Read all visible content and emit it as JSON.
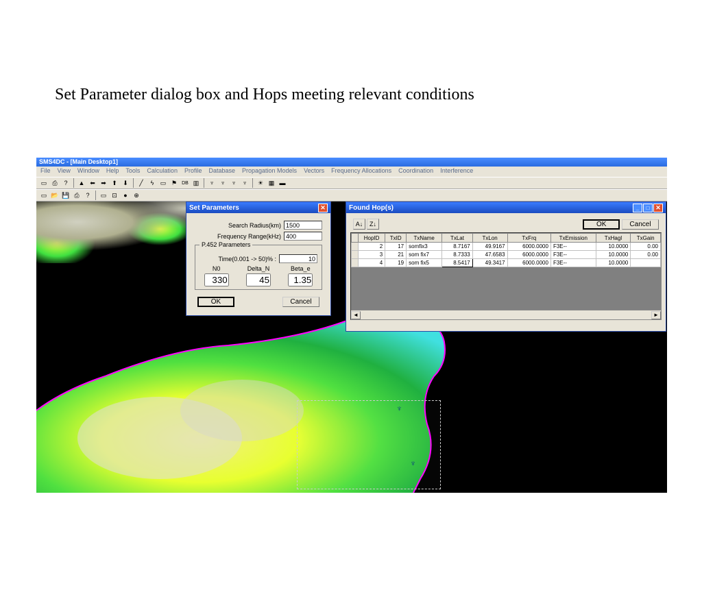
{
  "slide": {
    "title": "Set Parameter dialog box and Hops meeting relevant conditions"
  },
  "app": {
    "title": "SMS4DC - [Main Desktop1]",
    "menus": [
      "File",
      "View",
      "Window",
      "Help",
      "Tools",
      "Calculation",
      "Profile",
      "Database",
      "Propagation Models",
      "Vectors",
      "Frequency Allocations",
      "Coordination",
      "Interference"
    ]
  },
  "setparams": {
    "title": "Set Parameters",
    "search_radius_label": "Search Radius(km)",
    "search_radius": "1500",
    "freq_range_label": "Frequency Range(kHz)",
    "freq_range": "400",
    "p452_legend": "P.452 Parameters",
    "time_label": "Time(0.001 -> 50)% :",
    "time_val": "10",
    "n0_label": "N0",
    "n0_val": "330",
    "delta_n_label": "Delta_N",
    "delta_n_val": "45",
    "beta_e_label": "Beta_e",
    "beta_e_val": "1.35",
    "ok": "OK",
    "cancel": "Cancel"
  },
  "foundhops": {
    "title": "Found Hop(s)",
    "ok": "OK",
    "cancel": "Cancel",
    "headers": [
      "HopID",
      "TxID",
      "TxName",
      "TxLat",
      "TxLon",
      "TxFrq",
      "TxEmission",
      "TxHagl",
      "TxGain"
    ],
    "rows": [
      {
        "HopID": "2",
        "TxID": "17",
        "TxName": "somfix3",
        "TxLat": "8.7167",
        "TxLon": "49.9167",
        "TxFrq": "6000.0000",
        "TxEmission": "F3E--",
        "TxHagl": "10.0000",
        "TxGain": "0.00"
      },
      {
        "HopID": "3",
        "TxID": "21",
        "TxName": "som fix7",
        "TxLat": "8.7333",
        "TxLon": "47.6583",
        "TxFrq": "6000.0000",
        "TxEmission": "F3E--",
        "TxHagl": "10.0000",
        "TxGain": "0.00"
      },
      {
        "HopID": "4",
        "TxID": "19",
        "TxName": "som fix5",
        "TxLat": "8.5417",
        "TxLon": "49.3417",
        "TxFrq": "6000.0000",
        "TxEmission": "F3E--",
        "TxHagl": "10.0000",
        "TxGain": ""
      }
    ]
  }
}
